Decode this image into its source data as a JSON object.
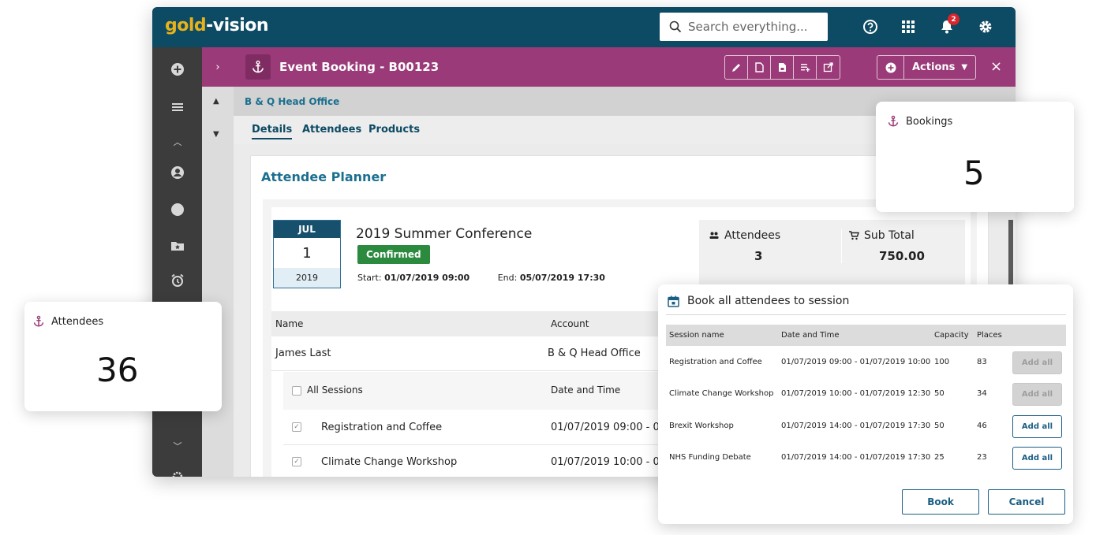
{
  "app": {
    "logo_part1": "gold",
    "logo_part2": "-vision",
    "search_placeholder": "Search everything...",
    "notification_count": "2",
    "record_title": "Event Booking - B00123",
    "actions_label": "Actions",
    "close_label": "×",
    "expand_label": "›",
    "breadcrumb": "B & Q Head Office",
    "tabs": [
      {
        "label": "Details"
      },
      {
        "label": "Attendees"
      },
      {
        "label": "Products"
      }
    ],
    "colors": {
      "topbar": "#0d4a63",
      "accent": "#9a3a78",
      "logo_gold": "#e7b21c",
      "confirmed": "#2c8a3f"
    }
  },
  "planner": {
    "title": "Attendee Planner",
    "calendar": {
      "month": "JUL",
      "day": "1",
      "year": "2019"
    },
    "event_title": "2019 Summer Conference",
    "status": "Confirmed",
    "start_label": "Start:",
    "start_value": "01/07/2019 09:00",
    "end_label": "End:",
    "end_value": "05/07/2019 17:30",
    "stats": {
      "attendees_label": "Attendees",
      "attendees_value": "3",
      "subtotal_label": "Sub Total",
      "subtotal_value": "750.00"
    },
    "table": {
      "col_name": "Name",
      "col_account": "Account",
      "attendee_name": "James Last",
      "attendee_account": "B & Q Head Office",
      "sessions_header": "All Sessions",
      "sessions_date_header": "Date and Time",
      "sessions": [
        {
          "name": "Registration and Coffee",
          "date": "01/07/2019 09:00 - 0"
        },
        {
          "name": "Climate Change Workshop",
          "date": "01/07/2019 10:00 - 0"
        }
      ]
    }
  },
  "cards": {
    "bookings": {
      "label": "Bookings",
      "value": "5"
    },
    "attendees": {
      "label": "Attendees",
      "value": "36"
    }
  },
  "modal": {
    "title": "Book all attendees to session",
    "headers": {
      "name": "Session name",
      "date": "Date and Time",
      "capacity": "Capacity",
      "places": "Places"
    },
    "rows": [
      {
        "name": "Registration and Coffee",
        "date": "01/07/2019 09:00 - 01/07/2019 10:00",
        "capacity": "100",
        "places": "83",
        "button": "Add all",
        "enabled": false
      },
      {
        "name": "Climate Change Workshop",
        "date": "01/07/2019 10:00 - 01/07/2019 12:30",
        "capacity": "50",
        "places": "34",
        "button": "Add all",
        "enabled": false
      },
      {
        "name": "Brexit Workshop",
        "date": "01/07/2019 14:00 - 01/07/2019 17:30",
        "capacity": "50",
        "places": "46",
        "button": "Add all",
        "enabled": true
      },
      {
        "name": "NHS Funding Debate",
        "date": "01/07/2019 14:00 - 01/07/2019 17:30",
        "capacity": "25",
        "places": "23",
        "button": "Add all",
        "enabled": true
      }
    ],
    "book_label": "Book",
    "cancel_label": "Cancel"
  },
  "icons": [
    "search-icon",
    "help-icon",
    "apps-grid-icon",
    "bell-icon",
    "gear-icon",
    "anchor-icon",
    "calendar-icon",
    "people-icon",
    "cart-icon"
  ]
}
